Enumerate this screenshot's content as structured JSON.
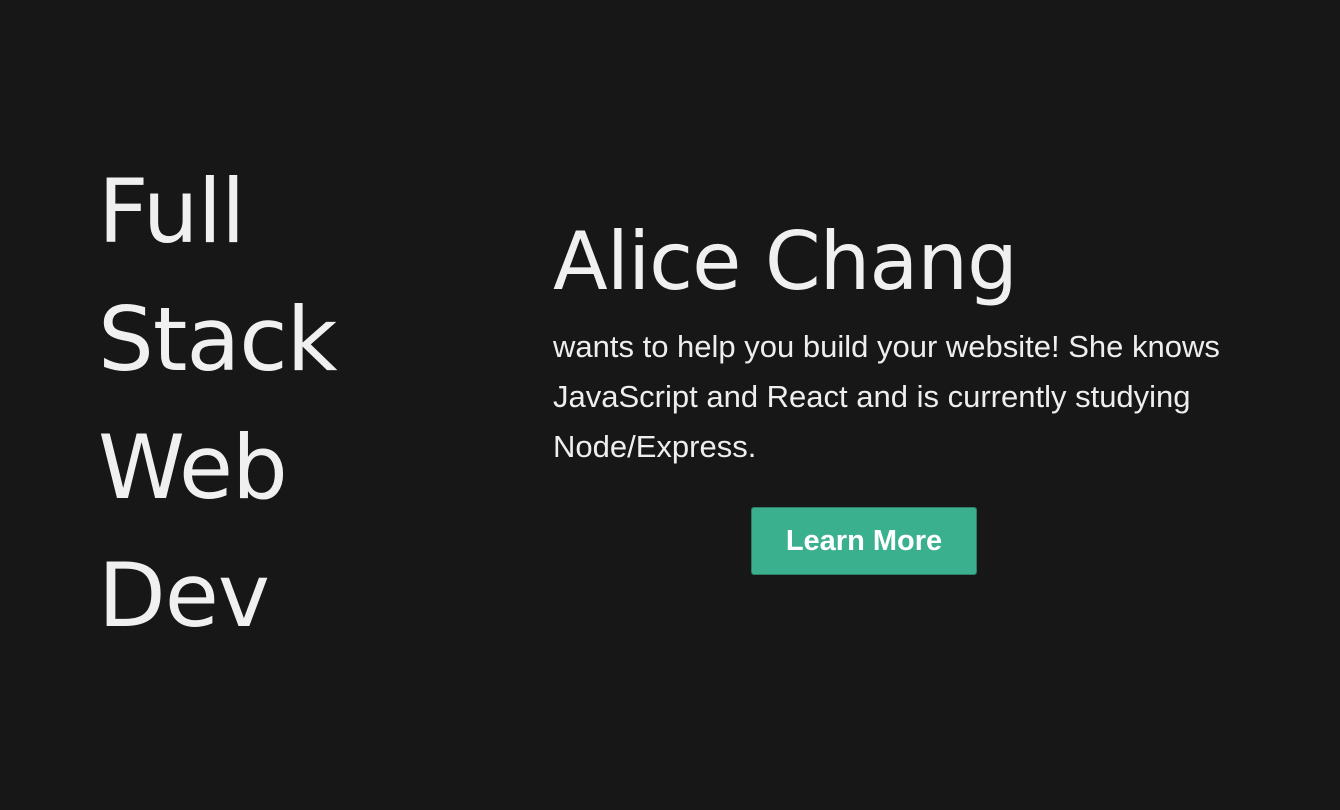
{
  "hero": {
    "tagline": [
      "Full",
      "Stack",
      "Web",
      "Dev"
    ],
    "name": "Alice Chang",
    "description": "wants to help you build your website! She knows JavaScript and React and is currently studying Node/Express.",
    "cta_label": "Learn More"
  },
  "colors": {
    "background": "#171717",
    "text": "#f0f0f0",
    "accent": "#3bb08f"
  }
}
